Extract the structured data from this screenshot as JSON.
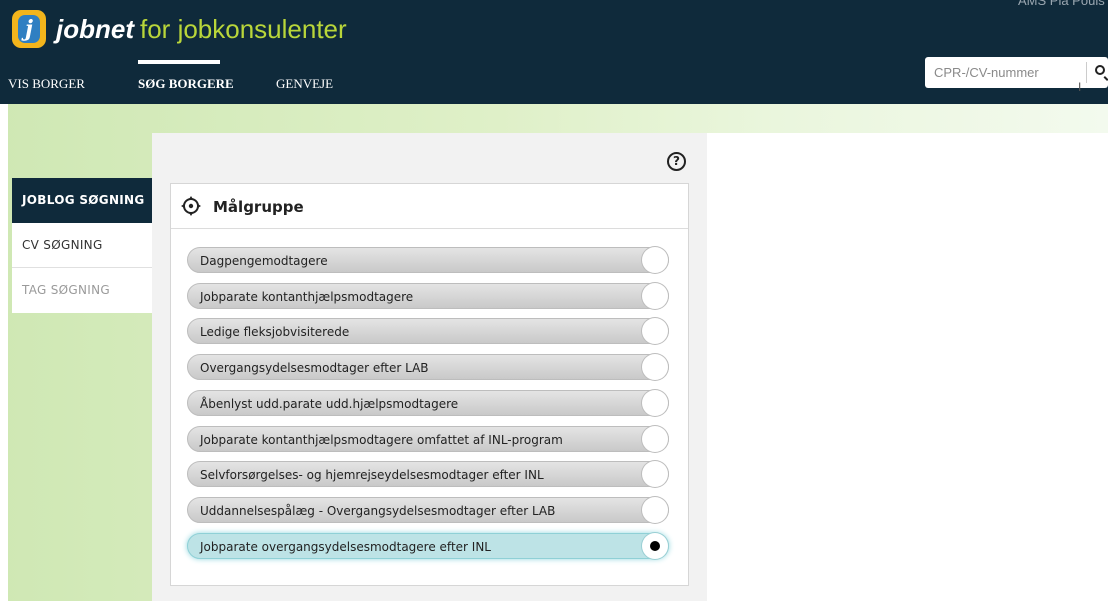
{
  "header": {
    "brand_name": "jobnet",
    "brand_suffix": "for jobkonsulenter",
    "user_text": "AMS  Pia Pouls",
    "logo_letter": "j"
  },
  "nav": {
    "items": [
      {
        "label": "VIS BORGER",
        "active": false
      },
      {
        "label": "SØG BORGERE",
        "active": true
      },
      {
        "label": "GENVEJE",
        "active": false
      }
    ]
  },
  "search": {
    "placeholder": "CPR-/CV-nummer",
    "icon": "search-icon"
  },
  "sidebar": {
    "items": [
      {
        "label": "JOBLOG SØGNING",
        "state": "active"
      },
      {
        "label": "CV SØGNING",
        "state": "normal"
      },
      {
        "label": "TAG SØGNING",
        "state": "muted"
      }
    ]
  },
  "help": {
    "label": "?"
  },
  "card": {
    "title": "Målgruppe",
    "icon": "target-icon",
    "options": [
      {
        "label": "Dagpengemodtagere",
        "selected": false
      },
      {
        "label": "Jobparate kontanthjælpsmodtagere",
        "selected": false
      },
      {
        "label": "Ledige fleksjobvisiterede",
        "selected": false
      },
      {
        "label": "Overgangsydelsesmodtager efter LAB",
        "selected": false
      },
      {
        "label": "Åbenlyst udd.parate udd.hjælpsmodtagere",
        "selected": false
      },
      {
        "label": "Jobparate kontanthjælpsmodtagere omfattet af INL-program",
        "selected": false
      },
      {
        "label": "Selvforsørgelses- og hjemrejseydelsesmodtager efter INL",
        "selected": false
      },
      {
        "label": "Uddannelsespålæg - Overgangsydelsesmodtager efter LAB",
        "selected": false
      },
      {
        "label": "Jobparate overgangsydelsesmodtagere efter INL",
        "selected": true
      }
    ]
  },
  "colors": {
    "header_bg": "#0f2a3b",
    "brand_accent": "#b9d63a",
    "selected_bg": "#bde3e6"
  }
}
